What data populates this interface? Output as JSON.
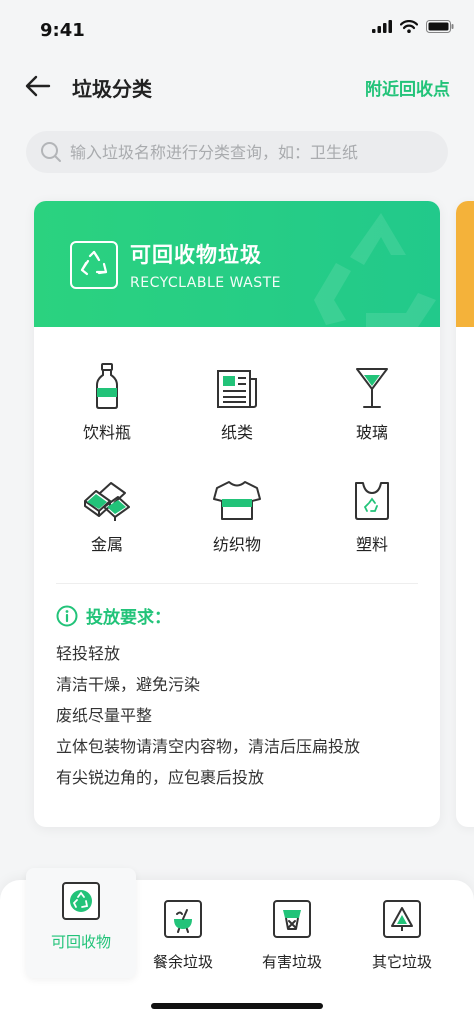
{
  "status": {
    "time": "9:41"
  },
  "nav": {
    "title": "垃圾分类",
    "nearby_link": "附近回收点"
  },
  "search": {
    "placeholder": "输入垃圾名称进行分类查询，如：卫生纸"
  },
  "card": {
    "title": "可回收物垃圾",
    "subtitle": "RECYCLABLE WASTE",
    "accent": "#22c379",
    "items": [
      {
        "label": "饮料瓶",
        "icon": "bottle-icon"
      },
      {
        "label": "纸类",
        "icon": "newspaper-icon"
      },
      {
        "label": "玻璃",
        "icon": "glass-icon"
      },
      {
        "label": "金属",
        "icon": "metal-bars-icon"
      },
      {
        "label": "纺织物",
        "icon": "tshirt-icon"
      },
      {
        "label": "塑料",
        "icon": "plastic-bag-icon"
      }
    ],
    "requirements": {
      "title": "投放要求：",
      "lines": [
        "轻投轻放",
        "清洁干燥，避免污染",
        "废纸尽量平整",
        "立体包装物请清空内容物，清洁后压扁投放",
        "有尖锐边角的，应包裹后投放"
      ]
    }
  },
  "peek_card_color": "#f4b23a",
  "tabs": [
    {
      "label": "可回收物",
      "icon": "recycle-icon",
      "active": true
    },
    {
      "label": "餐余垃圾",
      "icon": "food-waste-icon",
      "active": false
    },
    {
      "label": "有害垃圾",
      "icon": "hazardous-icon",
      "active": false
    },
    {
      "label": "其它垃圾",
      "icon": "other-waste-icon",
      "active": false
    }
  ]
}
